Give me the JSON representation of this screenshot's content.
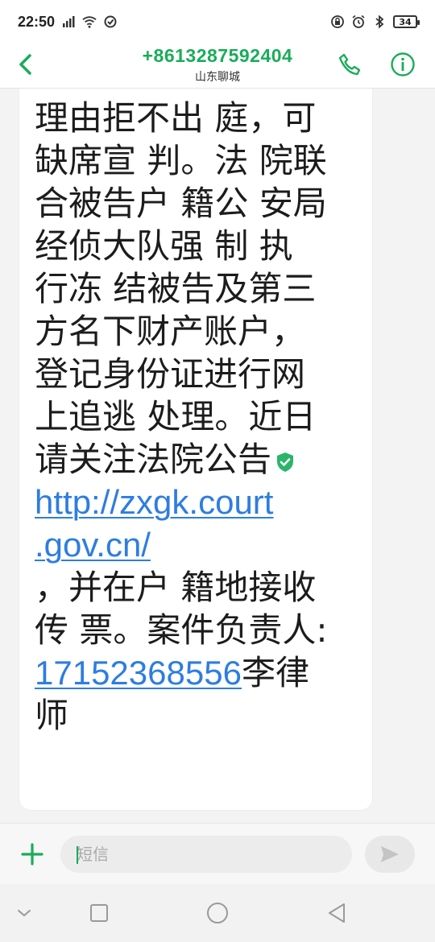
{
  "status_bar": {
    "time": "22:50",
    "battery": "34"
  },
  "header": {
    "contact_number": "+8613287592404",
    "region": "山东聊城"
  },
  "message": {
    "lines": [
      "理由拒不出 庭，可",
      "缺席宣 判。法 院联",
      "合被告户 籍公 安局",
      "经侦大队强 制 执",
      "行冻 结被告及第三",
      "方名下财产账户，",
      "登记身份证进行网",
      "上追逃 处理。近日",
      "请关注法院公告"
    ],
    "link_part1": "http://zxgk.court",
    "link_part2": ".gov.cn/",
    "after_link_lines": [
      "，并在户 籍地接收",
      "传 票。案件负责人:"
    ],
    "phone_link": "17152368556",
    "after_phone": "李律",
    "last_line": "师"
  },
  "input_bar": {
    "placeholder": "短信"
  },
  "colors": {
    "accent": "#1aac5a",
    "link": "#2e7de0"
  },
  "icons": [
    "back-icon",
    "phone-icon",
    "info-icon",
    "plus-icon",
    "send-icon",
    "shield-check-icon",
    "nav-back-icon",
    "nav-home-icon",
    "nav-recents-icon",
    "nav-down-icon"
  ]
}
